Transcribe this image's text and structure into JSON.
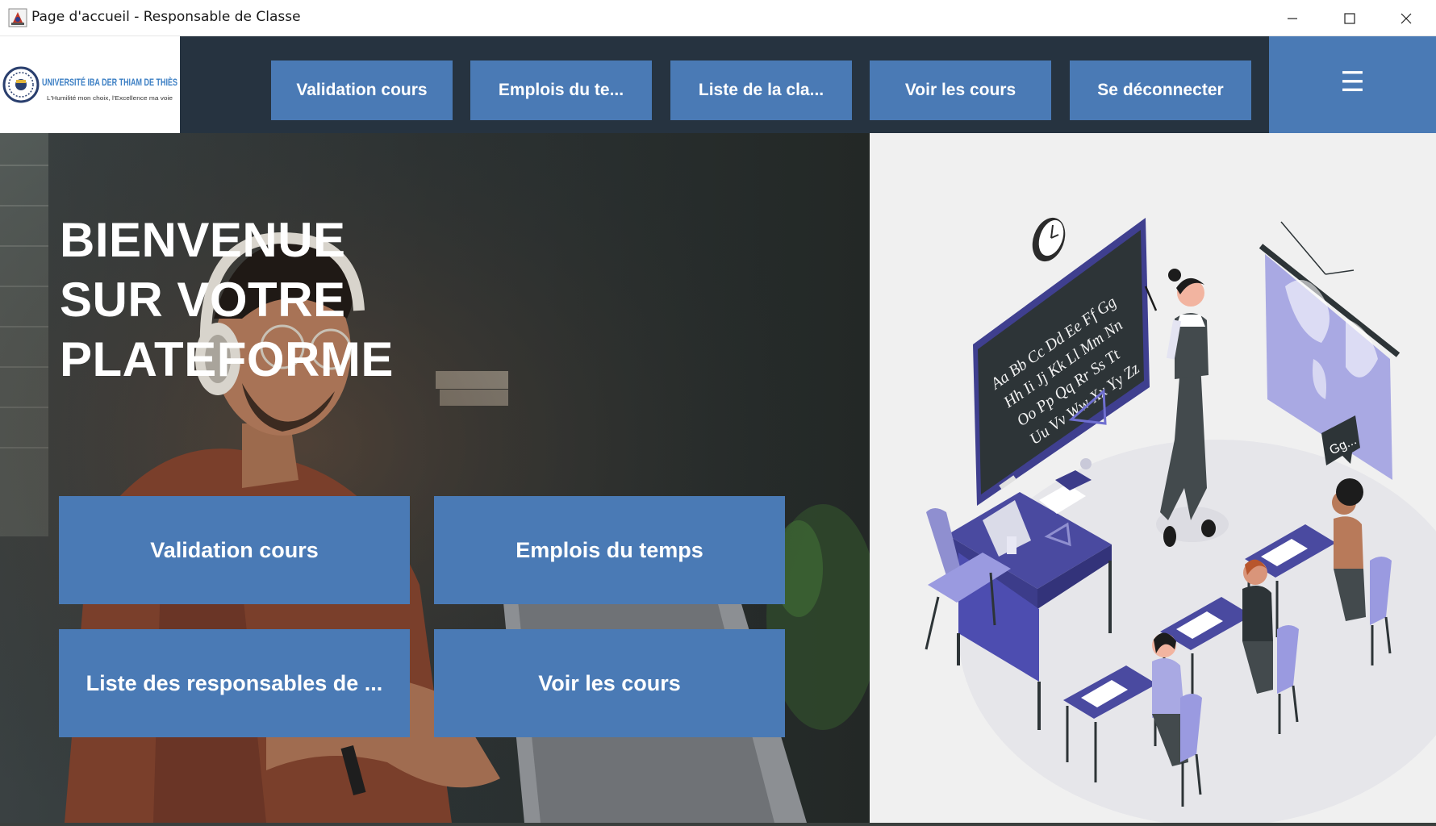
{
  "window": {
    "title": "Page d'accueil - Responsable de Classe",
    "controls": [
      "minimize-icon",
      "maximize-icon",
      "close-icon"
    ]
  },
  "logo": {
    "university_name": "UNIVERSITÉ IBA DER THIAM DE THIÈS",
    "motto": "L'Humilité mon choix, l'Excellence ma voie"
  },
  "nav": {
    "items": [
      {
        "label": "Validation cours"
      },
      {
        "label": "Emplois du te..."
      },
      {
        "label": "Liste de la cla..."
      },
      {
        "label": "Voir les cours"
      },
      {
        "label": "Se déconnecter"
      }
    ],
    "menu_icon": "☰"
  },
  "hero": {
    "welcome_lines": [
      "BIENVENUE",
      "SUR VOTRE",
      "PLATEFORME"
    ],
    "tiles": [
      {
        "label": "Validation cours"
      },
      {
        "label": "Emplois du temps"
      },
      {
        "label": "Liste des responsables de ..."
      },
      {
        "label": "Voir les cours"
      }
    ]
  },
  "illustration": {
    "chalkboard_lines": [
      "Aa Bb Cc Dd Ee Ff Gg",
      "Hh Ii Jj Kk Ll Mm Nn",
      "Oo Pp Qq Rr Ss Tt",
      "Uu Vv Ww Xx Yy Zz"
    ],
    "speech_bubble": "Gg..."
  },
  "colors": {
    "accent": "#4a7ab5",
    "navbar_bg": "#263340",
    "illustration_purple": "#5a5aa8"
  }
}
